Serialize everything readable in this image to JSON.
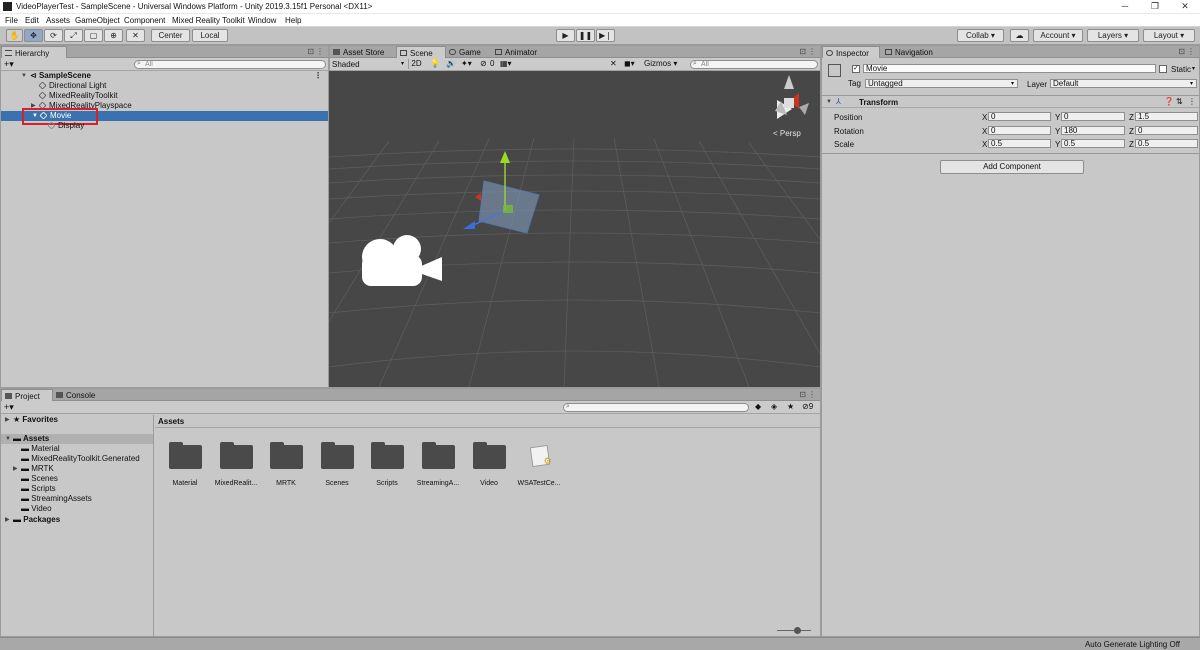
{
  "window": {
    "title": "VideoPlayerTest - SampleScene - Universal Windows Platform - Unity 2019.3.15f1 Personal <DX11>",
    "minimize": "─",
    "restore": "❐",
    "close": "✕"
  },
  "menu": [
    "File",
    "Edit",
    "Assets",
    "GameObject",
    "Component",
    "Mixed Reality Toolkit",
    "Window",
    "Help"
  ],
  "toolbar": {
    "pivot": "Center",
    "space": "Local",
    "collab": "Collab ▾",
    "account": "Account",
    "layers": "Layers",
    "layout": "Layout"
  },
  "hierarchy": {
    "tab": "Hierarchy",
    "create": "+▾",
    "search_placeholder": "All",
    "scene": "SampleScene",
    "items": [
      "Directional Light",
      "MixedRealityToolkit",
      "MixedRealityPlayspace",
      "Movie",
      "Display"
    ],
    "selected": "Movie"
  },
  "scene_tabs": {
    "asset_store": "Asset Store",
    "scene": "Scene",
    "game": "Game",
    "animator": "Animator"
  },
  "scene_toolbar": {
    "shading": "Shaded",
    "mode_2d": "2D",
    "hidden_count": "0",
    "gizmos": "Gizmos",
    "search_placeholder": "All",
    "persp": "< Persp"
  },
  "inspector": {
    "tab": "Inspector",
    "tab2": "Navigation",
    "object_name": "Movie",
    "static": "Static",
    "tag_label": "Tag",
    "tag_value": "Untagged",
    "layer_label": "Layer",
    "layer_value": "Default",
    "component": "Transform",
    "position_label": "Position",
    "rotation_label": "Rotation",
    "scale_label": "Scale",
    "position": {
      "x": "0",
      "y": "0",
      "z": "1.5"
    },
    "rotation": {
      "x": "0",
      "y": "180",
      "z": "0"
    },
    "scale": {
      "x": "0.5",
      "y": "0.5",
      "z": "0.5"
    },
    "axis_x": "X",
    "axis_y": "Y",
    "axis_z": "Z",
    "add_component": "Add Component"
  },
  "project": {
    "tab": "Project",
    "tab2": "Console",
    "create": "+▾",
    "hidden_count": "9",
    "favorites": "Favorites",
    "assets_root": "Assets",
    "tree": [
      "Material",
      "MixedRealityToolkit.Generated",
      "MRTK",
      "Scenes",
      "Scripts",
      "StreamingAssets",
      "Video"
    ],
    "packages": "Packages",
    "breadcrumb": "Assets",
    "grid": [
      "Material",
      "MixedRealit...",
      "MRTK",
      "Scenes",
      "Scripts",
      "StreamingA...",
      "Video",
      "WSATestCe..."
    ]
  },
  "status": {
    "text": "Auto Generate Lighting Off"
  },
  "colors": {
    "selection": "#3a72b0",
    "highlight_box": "#d8202a",
    "scene_bg": "#474747"
  }
}
